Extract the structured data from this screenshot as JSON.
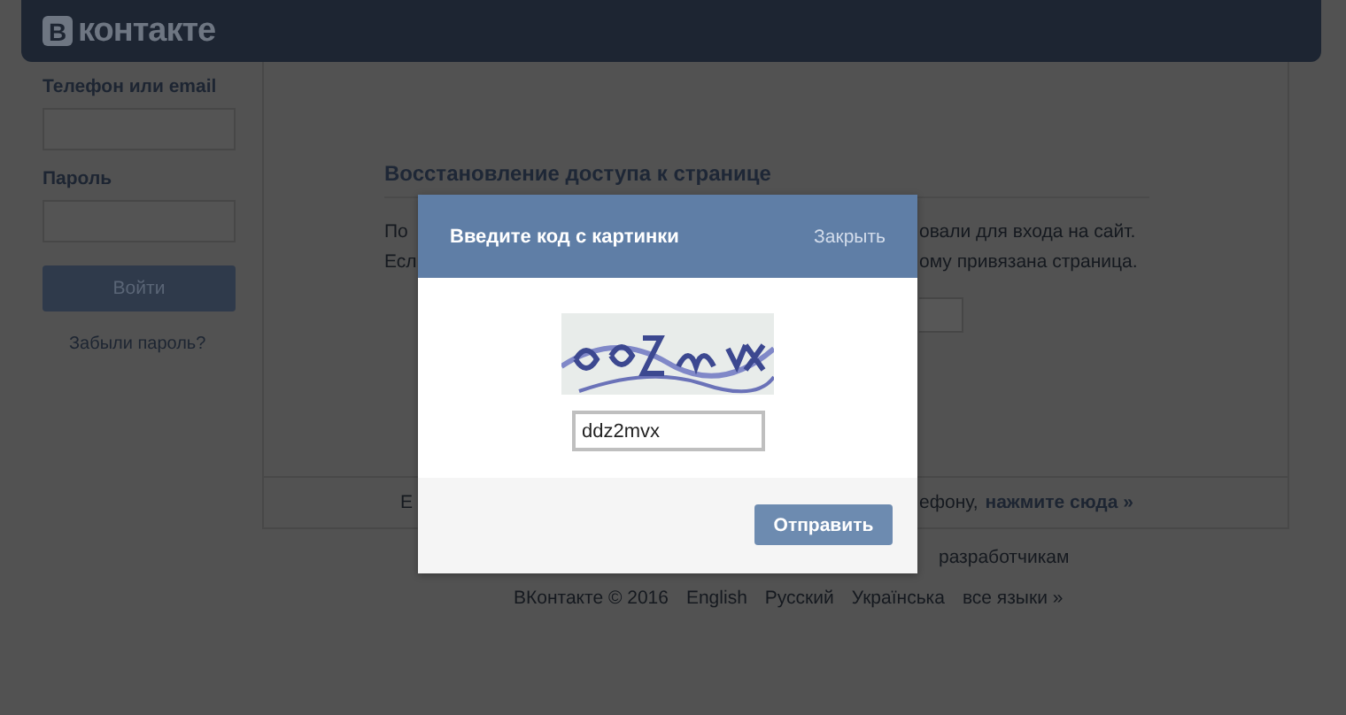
{
  "header": {
    "logo_letter": "В",
    "logo_text": "контакте"
  },
  "login": {
    "email_label": "Телефон или email",
    "password_label": "Пароль",
    "button": "Войти",
    "forgot_link": "Забыли пароль?"
  },
  "recovery": {
    "title": "Восстановление доступа к странице",
    "lines": [
      {
        "left": "По",
        "right": "овали для входа на сайт."
      },
      {
        "left": "Есл",
        "right": "ому привязана страница."
      }
    ],
    "bottom_left": "Е",
    "bottom_right": "ефону,",
    "bottom_link": "нажмите сюда »"
  },
  "footer": {
    "top_links": [
      "разработчикам"
    ],
    "copyright": "ВКонтакте © 2016",
    "languages": [
      "English",
      "Русский",
      "Українська",
      "все языки »"
    ]
  },
  "dialog": {
    "title": "Введите код с картинки",
    "close": "Закрыть",
    "code_value": "ddz2mvx",
    "submit": "Отправить"
  }
}
